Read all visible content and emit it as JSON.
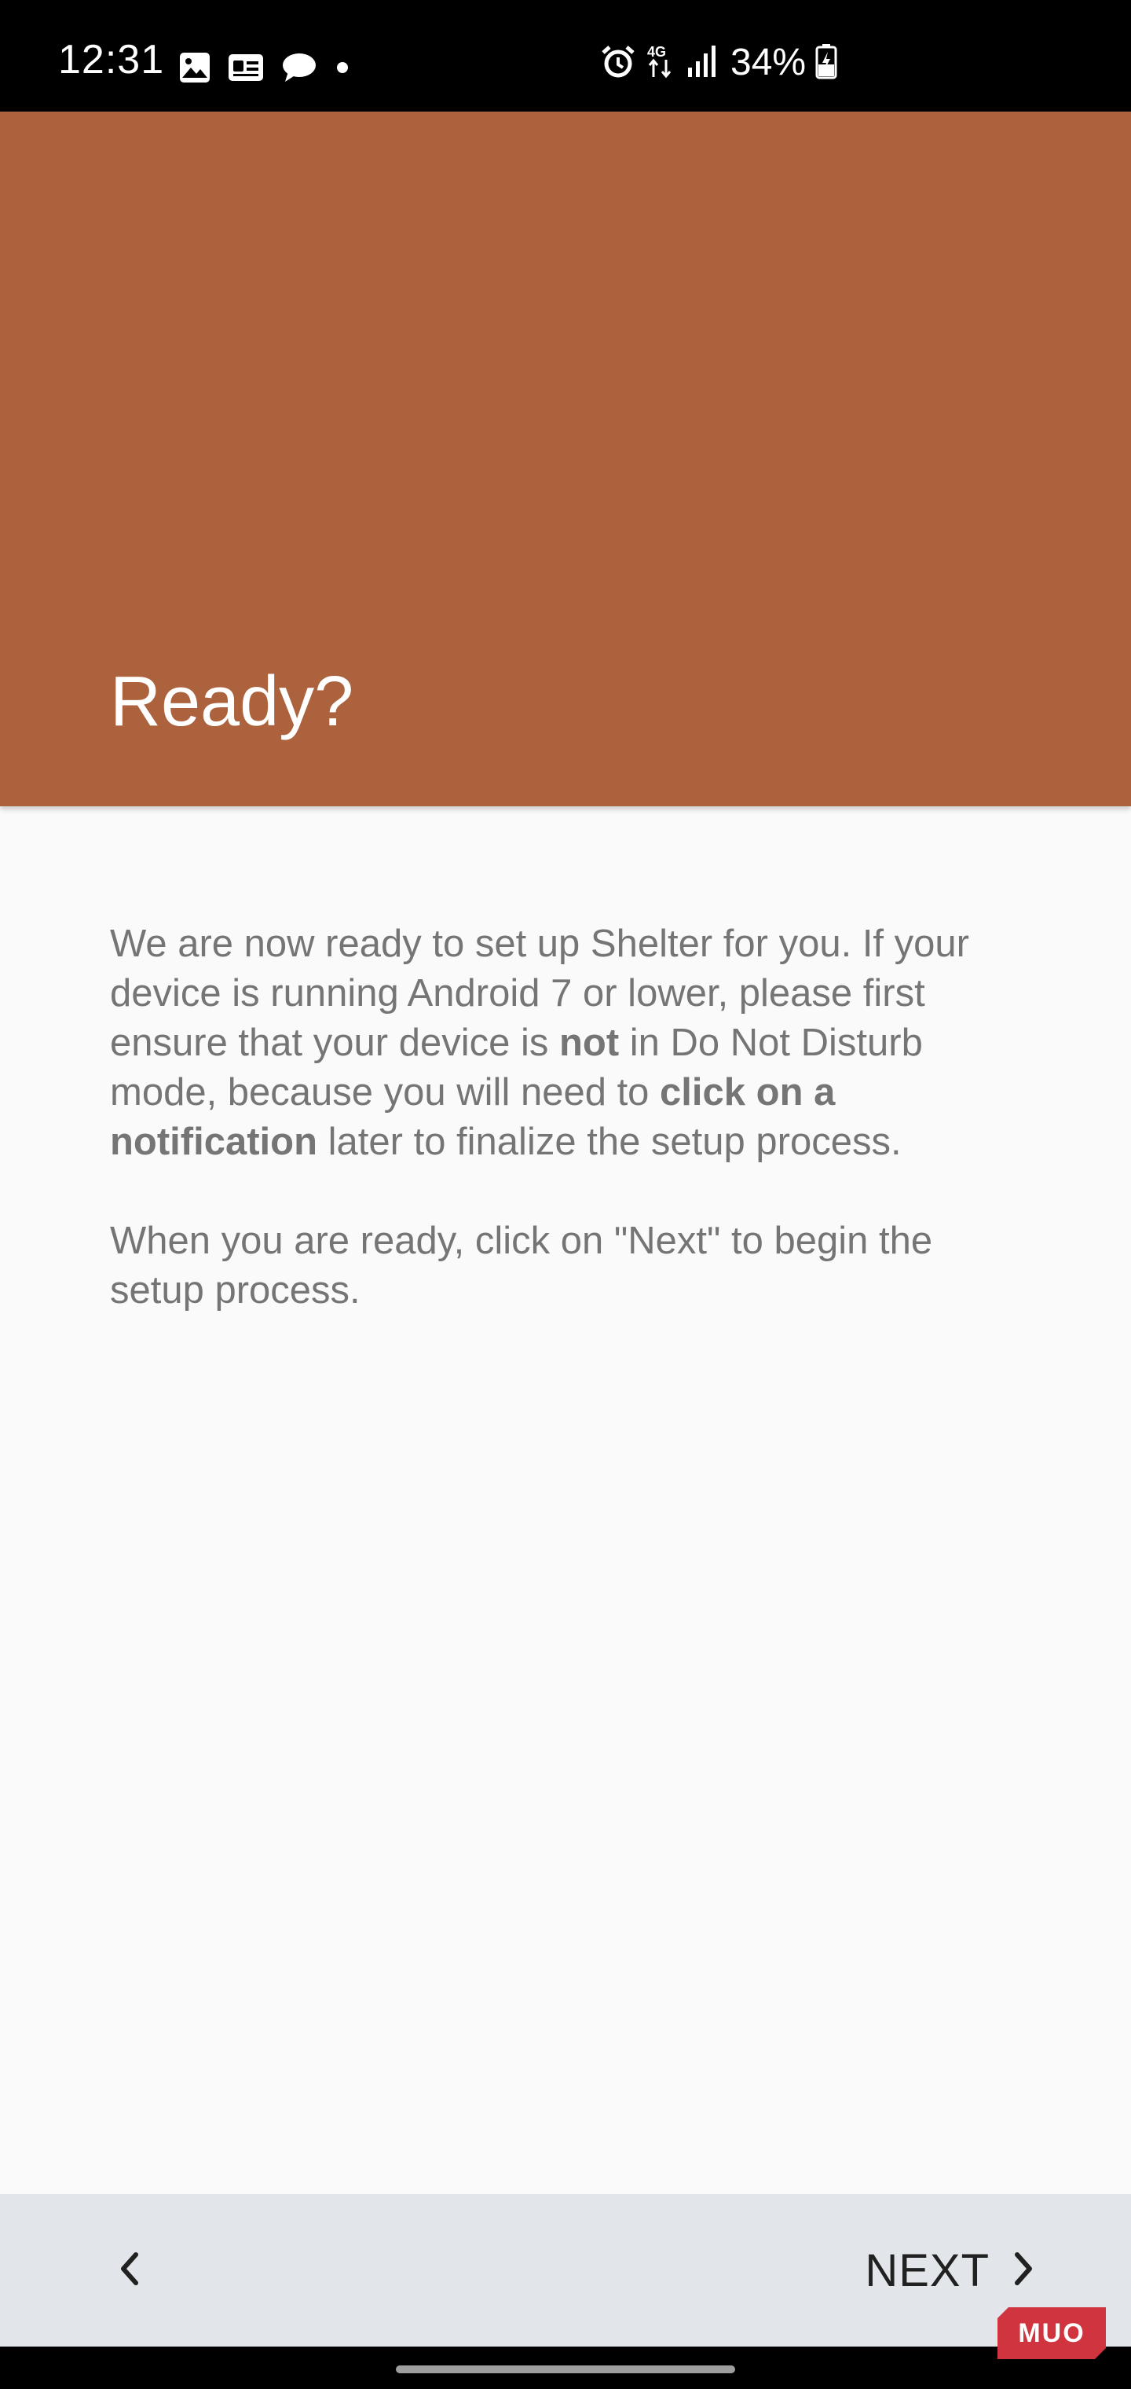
{
  "status_bar": {
    "time": "12:31",
    "left_icons": [
      "image-icon",
      "id-card-icon",
      "chat-bubble-icon",
      "dot-icon"
    ],
    "right_icons": [
      "alarm-icon",
      "4g-data-icon",
      "signal-icon",
      "battery-charging-icon"
    ],
    "battery_percent": "34%"
  },
  "header": {
    "title": "Ready?",
    "color": "#ad623e"
  },
  "content": {
    "paragraph1_parts": [
      "We are now ready to set up Shelter for you. If your device is running Android 7 or lower, please first ensure that your device is ",
      "not",
      " in Do Not Disturb mode, because you will need to ",
      "click on a notification",
      " later to finalize the setup process."
    ],
    "paragraph2": "When you are ready, click on \"Next\" to begin the setup process."
  },
  "navigation": {
    "back_icon": "chevron-left-icon",
    "next_label": "NEXT",
    "next_icon": "chevron-right-icon"
  },
  "watermark": {
    "text": "MUO",
    "color": "#d0353f"
  }
}
